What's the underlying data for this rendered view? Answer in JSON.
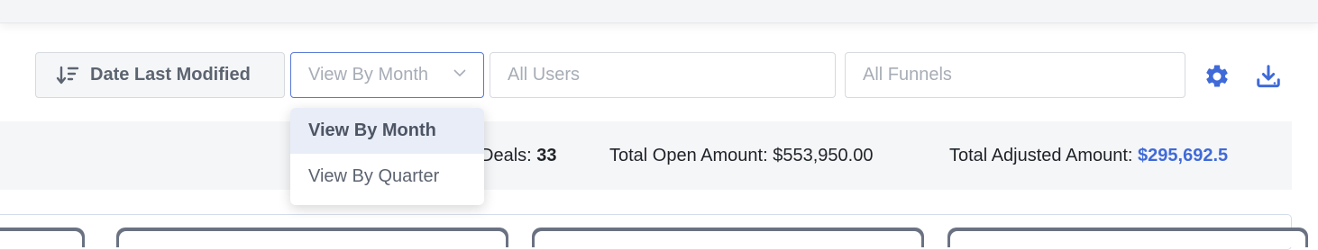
{
  "toolbar": {
    "sort_label": "Date Last Modified",
    "view_select_value": "View By Month",
    "users_placeholder": "All Users",
    "funnels_placeholder": "All Funnels",
    "icons": {
      "sort": "sort-descending-icon",
      "settings": "gear-icon",
      "download": "download-icon"
    }
  },
  "view_dropdown": {
    "options": [
      "View By Month",
      "View By Quarter"
    ],
    "selected_index": 0
  },
  "summary": {
    "deals_label": "Deals:",
    "deals_value": "33",
    "open_label": "Total Open Amount:",
    "open_value": "$553,950.00",
    "adjusted_label": "Total Adjusted Amount:",
    "adjusted_value": "$295,692.5"
  },
  "colors": {
    "accent": "#3f6ad8",
    "border_focus": "#5878d6"
  }
}
